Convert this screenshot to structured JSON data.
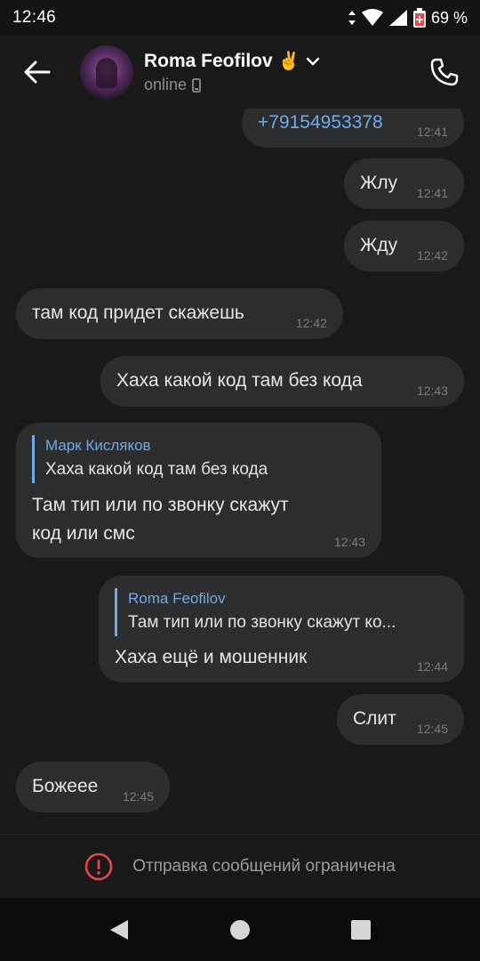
{
  "status_bar": {
    "time": "12:46",
    "battery": "69 %"
  },
  "header": {
    "name": "Roma Feofilov",
    "emoji": "✌",
    "status": "online"
  },
  "messages": [
    {
      "text": "+79154953378",
      "time": "12:41",
      "out": true
    },
    {
      "text": "Жлу",
      "time": "12:41",
      "out": true
    },
    {
      "text": "Жду",
      "time": "12:42",
      "out": true
    },
    {
      "text": "там код придет скажешь",
      "time": "12:42",
      "out": false
    },
    {
      "text": "Хаха какой код там без кода",
      "time": "12:43",
      "out": true
    },
    {
      "reply_name": "Марк Кисляков",
      "reply_text": "Хаха какой код там без кода",
      "text_line1": "Там тип или по звонку скажут",
      "text_line2": "код или смс",
      "time": "12:43",
      "out": false
    },
    {
      "reply_name": "Roma Feofilov",
      "reply_text": "Там тип или по звонку скажут ко...",
      "text": "Хаха ещё и мошенник",
      "time": "12:44",
      "out": true
    },
    {
      "text": "Слит",
      "time": "12:45",
      "out": true
    },
    {
      "text": "Божеее",
      "time": "12:45",
      "out": false
    }
  ],
  "restriction": {
    "text": "Отправка сообщений ограничена"
  },
  "colors": {
    "accent": "#71aaeb",
    "bubble": "#2c2d2e",
    "background": "#19191a",
    "warning": "#e64646"
  },
  "icons": {
    "back": "arrow-left-icon",
    "call": "phone-icon",
    "warning": "exclamation-circle-icon"
  }
}
